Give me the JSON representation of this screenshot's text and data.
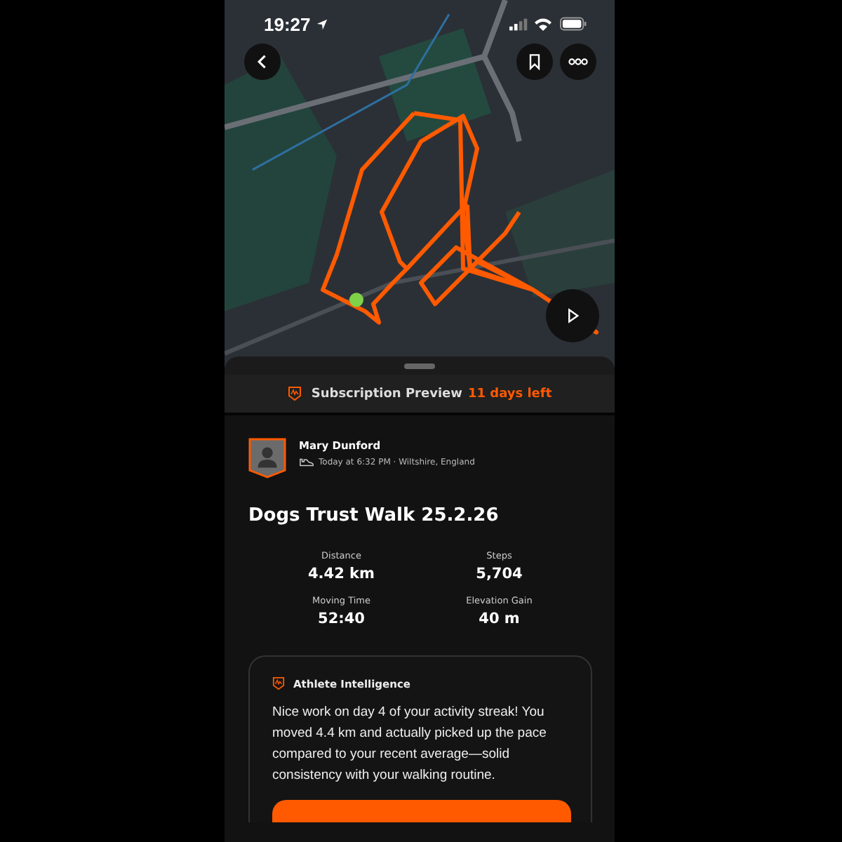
{
  "status_bar": {
    "time": "19:27"
  },
  "subscription": {
    "label": "Subscription Preview",
    "remaining": "11 days left"
  },
  "athlete": {
    "name": "Mary Dunford",
    "meta": "Today at 6:32 PM · Wiltshire, England"
  },
  "activity": {
    "title": "Dogs Trust Walk 25.2.26"
  },
  "stats": [
    {
      "label": "Distance",
      "value": "4.42 km"
    },
    {
      "label": "Steps",
      "value": "5,704"
    },
    {
      "label": "Moving Time",
      "value": "52:40"
    },
    {
      "label": "Elevation Gain",
      "value": "40 m"
    }
  ],
  "insight": {
    "title": "Athlete Intelligence",
    "text": "Nice work on day 4 of your activity streak! You moved 4.4 km and actually picked up the pace compared to your recent average—solid consistency with your walking routine."
  }
}
